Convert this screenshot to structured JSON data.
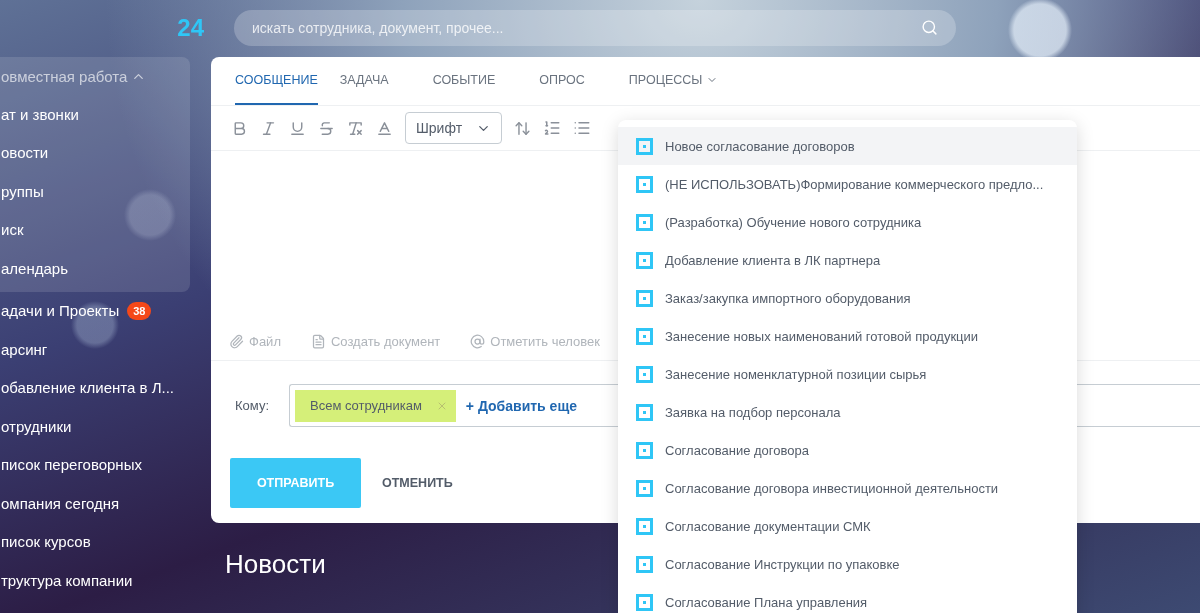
{
  "logo": {
    "text": "24"
  },
  "search": {
    "placeholder": "искать сотрудника, документ, прочее..."
  },
  "sidebar": {
    "group": {
      "title": "овместная работа",
      "expanded": true,
      "items": [
        {
          "label": "ат и звонки"
        },
        {
          "label": "овости"
        },
        {
          "label": "руппы"
        },
        {
          "label": "иск"
        },
        {
          "label": "алендарь"
        }
      ]
    },
    "items": [
      {
        "label": "адачи и Проекты",
        "badge": "38"
      },
      {
        "label": "арсинг"
      },
      {
        "label": "обавление клиента в Л..."
      },
      {
        "label": "отрудники"
      },
      {
        "label": "писок переговорных"
      },
      {
        "label": "омпания сегодня"
      },
      {
        "label": "писок курсов"
      },
      {
        "label": "труктура компании"
      }
    ]
  },
  "composer": {
    "tabs": [
      {
        "label": "СООБЩЕНИЕ",
        "selected": true,
        "kind": "plain"
      },
      {
        "label": "ЗАДАЧА",
        "selected": false,
        "kind": "plain"
      },
      {
        "label": "СОБЫТИЕ",
        "selected": false,
        "kind": "plain"
      },
      {
        "label": "ОПРОС",
        "selected": false,
        "kind": "plain"
      },
      {
        "label": "ПРОЦЕССЫ",
        "selected": false,
        "kind": "menu"
      }
    ],
    "font_select": "Шрифт",
    "attachments": [
      {
        "kind": "file",
        "label": "Файл"
      },
      {
        "kind": "document",
        "label": "Создать документ"
      },
      {
        "kind": "mention",
        "label": "Отметить человек"
      }
    ],
    "recipients": {
      "label": "Кому:",
      "chips": [
        "Всем сотрудникам"
      ],
      "add_link": "+ Добавить еще"
    },
    "buttons": {
      "send": "ОТПРАВИТЬ",
      "cancel": "ОТМЕНИТЬ"
    }
  },
  "processes_menu": {
    "items": [
      {
        "label": "Новое согласование договоров",
        "selected": true
      },
      {
        "label": "(НЕ ИСПОЛЬЗОВАТЬ)Формирование коммерческого предло...",
        "selected": false
      },
      {
        "label": "(Разработка) Обучение нового сотрудника",
        "selected": false
      },
      {
        "label": "Добавление клиента в ЛК партнера",
        "selected": false
      },
      {
        "label": "Заказ/закупка импортного оборудования",
        "selected": false
      },
      {
        "label": "Занесение новых наименований готовой продукции",
        "selected": false
      },
      {
        "label": "Занесение номенклатурной позиции сырья",
        "selected": false
      },
      {
        "label": "Заявка на подбор персонала",
        "selected": false
      },
      {
        "label": "Согласование договора",
        "selected": false
      },
      {
        "label": "Согласование договора инвестиционной деятельности",
        "selected": false
      },
      {
        "label": "Согласование документации СМК",
        "selected": false
      },
      {
        "label": "Согласование Инструкции по упаковке",
        "selected": false
      },
      {
        "label": "Согласование Плана управления",
        "selected": false
      }
    ]
  },
  "heading": "Новости"
}
